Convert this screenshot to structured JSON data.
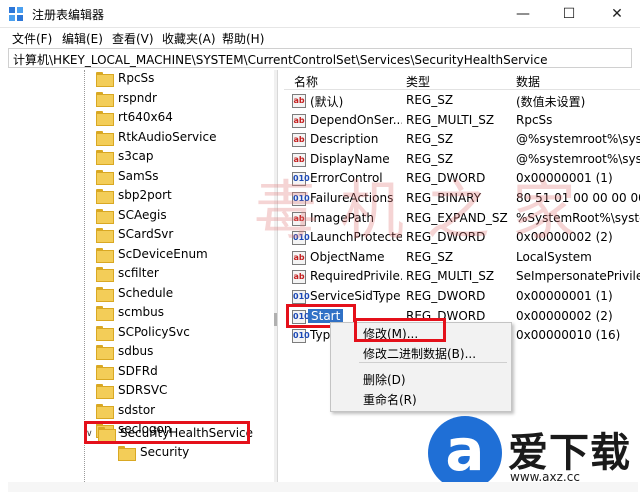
{
  "window": {
    "title": "注册表编辑器",
    "minimize_glyph": "—",
    "maximize_glyph": "☐",
    "close_glyph": "✕"
  },
  "menu": {
    "file": "文件(F)",
    "edit": "编辑(E)",
    "view": "查看(V)",
    "favorites": "收藏夹(A)",
    "help": "帮助(H)"
  },
  "address": "计算机\\HKEY_LOCAL_MACHINE\\SYSTEM\\CurrentControlSet\\Services\\SecurityHealthService",
  "tree": {
    "items": [
      {
        "label": "RpcSs"
      },
      {
        "label": "rspndr"
      },
      {
        "label": "rt640x64"
      },
      {
        "label": "RtkAudioService"
      },
      {
        "label": "s3cap"
      },
      {
        "label": "SamSs"
      },
      {
        "label": "sbp2port"
      },
      {
        "label": "SCAegis"
      },
      {
        "label": "SCardSvr"
      },
      {
        "label": "ScDeviceEnum"
      },
      {
        "label": "scfilter"
      },
      {
        "label": "Schedule"
      },
      {
        "label": "scmbus"
      },
      {
        "label": "SCPolicySvc"
      },
      {
        "label": "sdbus"
      },
      {
        "label": "SDFRd"
      },
      {
        "label": "SDRSVC"
      },
      {
        "label": "sdstor"
      },
      {
        "label": "seclogon"
      },
      {
        "label": "SecurityHealthService",
        "expanded_glyph": "∨"
      },
      {
        "label": "Security"
      }
    ]
  },
  "values_list": {
    "columns": {
      "name": "名称",
      "type": "类型",
      "data": "数据"
    },
    "rows": [
      {
        "icon": "ab",
        "name": "(默认)",
        "type": "REG_SZ",
        "data": "(数值未设置)"
      },
      {
        "icon": "ab",
        "name": "DependOnSer...",
        "type": "REG_MULTI_SZ",
        "data": "RpcSs"
      },
      {
        "icon": "ab",
        "name": "Description",
        "type": "REG_SZ",
        "data": "@%systemroot%\\sys"
      },
      {
        "icon": "ab",
        "name": "DisplayName",
        "type": "REG_SZ",
        "data": "@%systemroot%\\sys"
      },
      {
        "icon": "010",
        "name": "ErrorControl",
        "type": "REG_DWORD",
        "data": "0x00000001 (1)"
      },
      {
        "icon": "010",
        "name": "FailureActions",
        "type": "REG_BINARY",
        "data": "80 51 01 00 00 00 00"
      },
      {
        "icon": "ab",
        "name": "ImagePath",
        "type": "REG_EXPAND_SZ",
        "data": "%SystemRoot%\\syste"
      },
      {
        "icon": "010",
        "name": "LaunchProtected",
        "type": "REG_DWORD",
        "data": "0x00000002 (2)"
      },
      {
        "icon": "ab",
        "name": "ObjectName",
        "type": "REG_SZ",
        "data": "LocalSystem"
      },
      {
        "icon": "ab",
        "name": "RequiredPrivile...",
        "type": "REG_MULTI_SZ",
        "data": "SeImpersonatePrivile"
      },
      {
        "icon": "010",
        "name": "ServiceSidType",
        "type": "REG_DWORD",
        "data": "0x00000001 (1)"
      },
      {
        "icon": "010",
        "name": "Start",
        "type": "REG_DWORD",
        "data": "0x00000002 (2)",
        "selected": true
      },
      {
        "icon": "010",
        "name": "Type",
        "type": "REG_DWORD",
        "data": "0x00000010 (16)"
      }
    ]
  },
  "context_menu": {
    "modify": "修改(M)...",
    "modify_binary": "修改二进制数据(B)...",
    "delete": "删除(D)",
    "rename": "重命名(R)"
  },
  "watermark": "毒机之家",
  "logo": {
    "mark": "a",
    "text": "爱下载",
    "url": "www.axz.cc"
  },
  "colors": {
    "highlight_box": "#e4101a",
    "selection": "#3071c6",
    "logo_blue": "#1f6fd6",
    "folder": "#f3cd58"
  }
}
